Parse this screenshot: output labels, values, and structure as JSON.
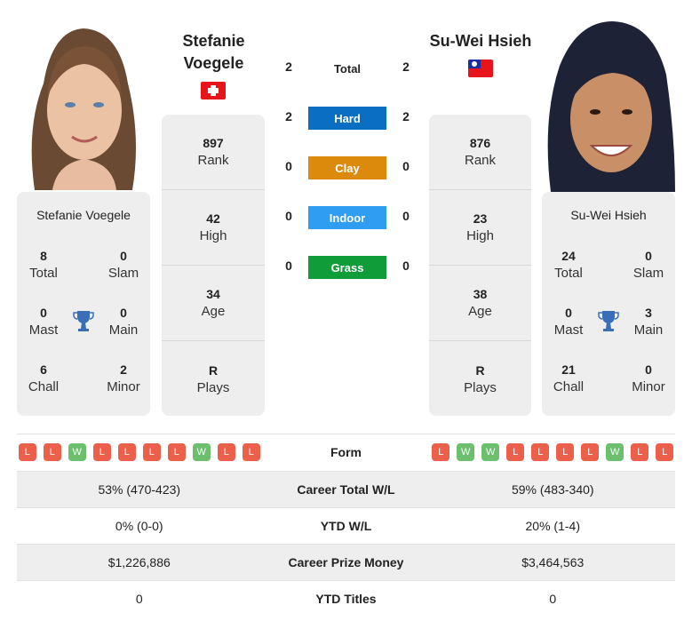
{
  "colors": {
    "hard": "#0a6ec3",
    "clay": "#dc8a0c",
    "indoor": "#2e9df2",
    "grass": "#119c3a",
    "loss": "#ec5f4a",
    "win": "#6cbf6c",
    "trophy": "#3a6fb8"
  },
  "player1": {
    "name_line1": "Stefanie",
    "name_line2": "Voegele",
    "card_name": "Stefanie Voegele",
    "flag": "switzerland-flag",
    "photo": "player-photo-stefanie-voegele",
    "stats": [
      {
        "value": "897",
        "label": "Rank"
      },
      {
        "value": "42",
        "label": "High"
      },
      {
        "value": "34",
        "label": "Age"
      },
      {
        "value": "R",
        "label": "Plays"
      }
    ],
    "titles": {
      "total": {
        "value": "8",
        "label": "Total"
      },
      "slam": {
        "value": "0",
        "label": "Slam"
      },
      "mast": {
        "value": "0",
        "label": "Mast"
      },
      "main": {
        "value": "0",
        "label": "Main"
      },
      "chall": {
        "value": "6",
        "label": "Chall"
      },
      "minor": {
        "value": "2",
        "label": "Minor"
      }
    },
    "form": [
      "L",
      "L",
      "W",
      "L",
      "L",
      "L",
      "L",
      "W",
      "L",
      "L"
    ]
  },
  "player2": {
    "name": "Su-Wei Hsieh",
    "card_name": "Su-Wei Hsieh",
    "flag": "taiwan-flag",
    "photo": "player-photo-su-wei-hsieh",
    "stats": [
      {
        "value": "876",
        "label": "Rank"
      },
      {
        "value": "23",
        "label": "High"
      },
      {
        "value": "38",
        "label": "Age"
      },
      {
        "value": "R",
        "label": "Plays"
      }
    ],
    "titles": {
      "total": {
        "value": "24",
        "label": "Total"
      },
      "slam": {
        "value": "0",
        "label": "Slam"
      },
      "mast": {
        "value": "0",
        "label": "Mast"
      },
      "main": {
        "value": "3",
        "label": "Main"
      },
      "chall": {
        "value": "21",
        "label": "Chall"
      },
      "minor": {
        "value": "0",
        "label": "Minor"
      }
    },
    "form": [
      "L",
      "W",
      "W",
      "L",
      "L",
      "L",
      "L",
      "W",
      "L",
      "L"
    ]
  },
  "h2h": [
    {
      "label": "Total",
      "p1": "2",
      "p2": "2",
      "surface": "total"
    },
    {
      "label": "Hard",
      "p1": "2",
      "p2": "2",
      "surface": "hard"
    },
    {
      "label": "Clay",
      "p1": "0",
      "p2": "0",
      "surface": "clay"
    },
    {
      "label": "Indoor",
      "p1": "0",
      "p2": "0",
      "surface": "indoor"
    },
    {
      "label": "Grass",
      "p1": "0",
      "p2": "0",
      "surface": "grass"
    }
  ],
  "comparison": {
    "form_label": "Form",
    "rows": [
      {
        "label": "Career Total W/L",
        "p1": "53% (470-423)",
        "p2": "59% (483-340)"
      },
      {
        "label": "YTD W/L",
        "p1": "0% (0-0)",
        "p2": "20% (1-4)"
      },
      {
        "label": "Career Prize Money",
        "p1": "$1,226,886",
        "p2": "$3,464,563"
      },
      {
        "label": "YTD Titles",
        "p1": "0",
        "p2": "0"
      }
    ]
  }
}
